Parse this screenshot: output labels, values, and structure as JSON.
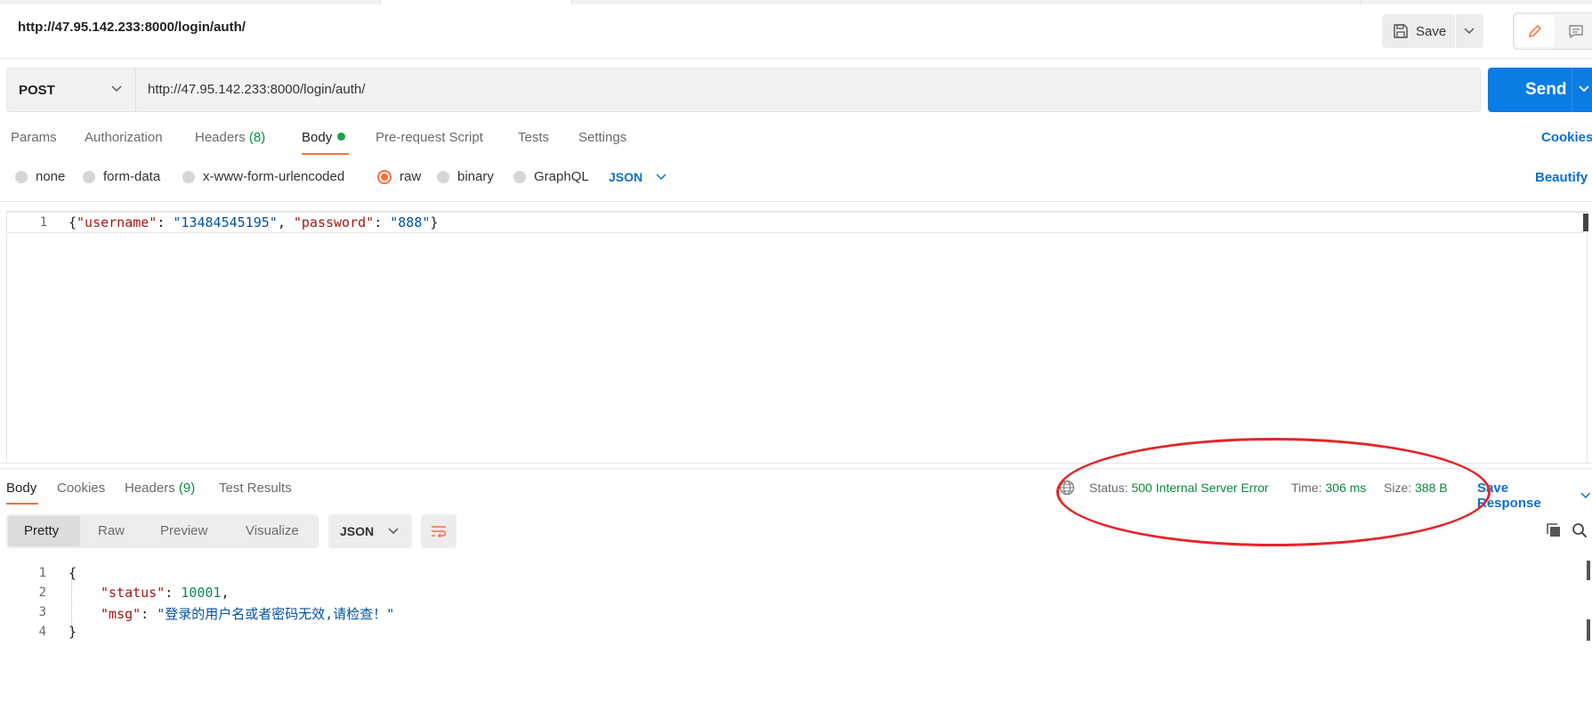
{
  "request": {
    "name": "http://47.95.142.233:8000/login/auth/",
    "method": "POST",
    "url": "http://47.95.142.233:8000/login/auth/",
    "save_label": "Save",
    "send_label": "Send"
  },
  "request_tabs": {
    "params": "Params",
    "authorization": "Authorization",
    "headers": "Headers",
    "headers_count": "(8)",
    "body": "Body",
    "pre_request": "Pre-request Script",
    "tests": "Tests",
    "settings": "Settings",
    "cookies": "Cookies"
  },
  "body_types": {
    "none": "none",
    "form_data": "form-data",
    "urlencoded": "x-www-form-urlencoded",
    "raw": "raw",
    "binary": "binary",
    "graphql": "GraphQL",
    "selected": "raw",
    "format": "JSON",
    "beautify": "Beautify"
  },
  "request_body": {
    "line_number": "1",
    "brace_open": "{",
    "key1": "\"username\"",
    "colon1": ": ",
    "val1": "\"13484545195\"",
    "comma": ", ",
    "key2": "\"password\"",
    "colon2": ": ",
    "val2": "\"888\"",
    "brace_close": "}"
  },
  "response_tabs": {
    "body": "Body",
    "cookies": "Cookies",
    "headers": "Headers",
    "headers_count": "(9)",
    "test_results": "Test Results"
  },
  "response_meta": {
    "status_label": "Status:",
    "status_value": "500 Internal Server Error",
    "time_label": "Time:",
    "time_value": "306 ms",
    "size_label": "Size:",
    "size_value": "388 B",
    "save_response": "Save Response"
  },
  "response_view": {
    "pretty": "Pretty",
    "raw": "Raw",
    "preview": "Preview",
    "visualize": "Visualize",
    "format": "JSON"
  },
  "response_body": {
    "ln1": "1",
    "ln2": "2",
    "ln3": "3",
    "ln4": "4",
    "brace_open": "{",
    "key_status": "\"status\"",
    "colon": ": ",
    "val_status": "10001",
    "comma": ",",
    "key_msg": "\"msg\"",
    "val_msg": "\"登录的用户名或者密码无效,请检查！\"",
    "brace_close": "}"
  },
  "colors": {
    "accent": "#ff6c37",
    "primary": "#0c7ce5",
    "success": "#0b8a3e",
    "annotation": "#e3262a"
  }
}
